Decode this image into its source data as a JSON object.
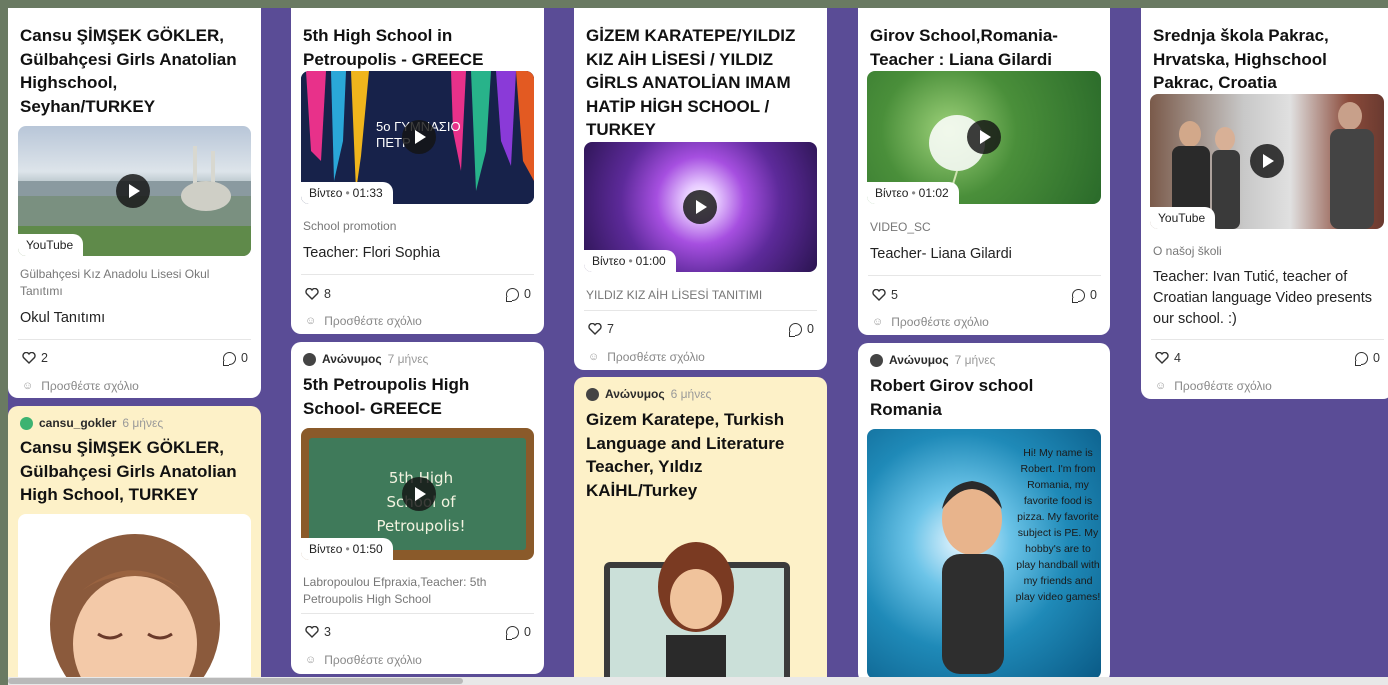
{
  "common": {
    "add_comment": "Προσθέστε σχόλιο",
    "anonymous": "Ανώνυμος"
  },
  "colors": {
    "board": "#5a4c96",
    "card": "#ffffff",
    "card_yellow": "#fdf1c8"
  },
  "cards": {
    "c1": {
      "title": "Cansu ŞİMŞEK GÖKLER, Gülbahçesi Girls Anatolian Highschool, Seyhan/TURKEY",
      "badge": "YouTube",
      "subtitle": "Gülbahçesi Kız Anadolu Lisesi Okul Tanıtımı",
      "description": "Okul Tanıtımı",
      "likes": "2",
      "comments": "0"
    },
    "c2": {
      "author": "cansu_gokler",
      "time": "6 μήνες",
      "title": "Cansu ŞİMŞEK GÖKLER, Gülbahçesi Girls Anatolian High School, TURKEY"
    },
    "c3": {
      "title": "5th High School in Petroupolis - GREECE",
      "media_text": "5o ΓΥΜΝΑΣΙΟ ΠΕΤΡ",
      "badge_kind": "Βίντεο",
      "badge_dot": "•",
      "badge_time": "01:33",
      "subtitle": "School promotion",
      "description": "Teacher: Flori Sophia",
      "likes": "8",
      "comments": "0"
    },
    "c4": {
      "time": "7 μήνες",
      "title": "5th Petroupolis High School- GREECE",
      "media_text": "5th High School of Petroupolis!",
      "badge_kind": "Βίντεο",
      "badge_dot": "•",
      "badge_time": "01:50",
      "subtitle": "Labropoulou Efpraxia,Teacher: 5th Petroupolis High School",
      "likes": "3",
      "comments": "0"
    },
    "c5": {
      "title": "GİZEM KARATEPE/YILDIZ KIZ AİH LİSESİ / YILDIZ GİRLS ANATOLİAN IMAM HATİP HİGH SCHOOL / TURKEY",
      "badge_kind": "Βίντεο",
      "badge_dot": "•",
      "badge_time": "01:00",
      "subtitle": "YILDIZ KIZ AİH LİSESİ TANITIMI",
      "likes": "7",
      "comments": "0"
    },
    "c6": {
      "time": "6 μήνες",
      "title": "Gizem Karatepe, Turkish Language and Literature Teacher, Yıldız KAİHL/Turkey"
    },
    "c7": {
      "title": "Girov School,Romania- Teacher : Liana Gilardi",
      "badge_kind": "Βίντεο",
      "badge_dot": "•",
      "badge_time": "01:02",
      "subtitle": "VIDEO_SC",
      "description": "Teacher- Liana Gilardi",
      "likes": "5",
      "comments": "0"
    },
    "c8": {
      "time": "7 μήνες",
      "title": "Robert Girov school Romania",
      "media_text": "Hi! My name is Robert. I'm from Romania, my favorite food is pizza. My favorite subject is PE. My hobby's are to play handball with my friends and play video games!"
    },
    "c9": {
      "title": "Srednja škola Pakrac, Hrvatska, Highschool Pakrac, Croatia",
      "badge": "YouTube",
      "subtitle": "O našoj školi",
      "description": "Teacher: Ivan Tutić, teacher of Croatian language Video presents our school. :)",
      "likes": "4",
      "comments": "0"
    }
  }
}
